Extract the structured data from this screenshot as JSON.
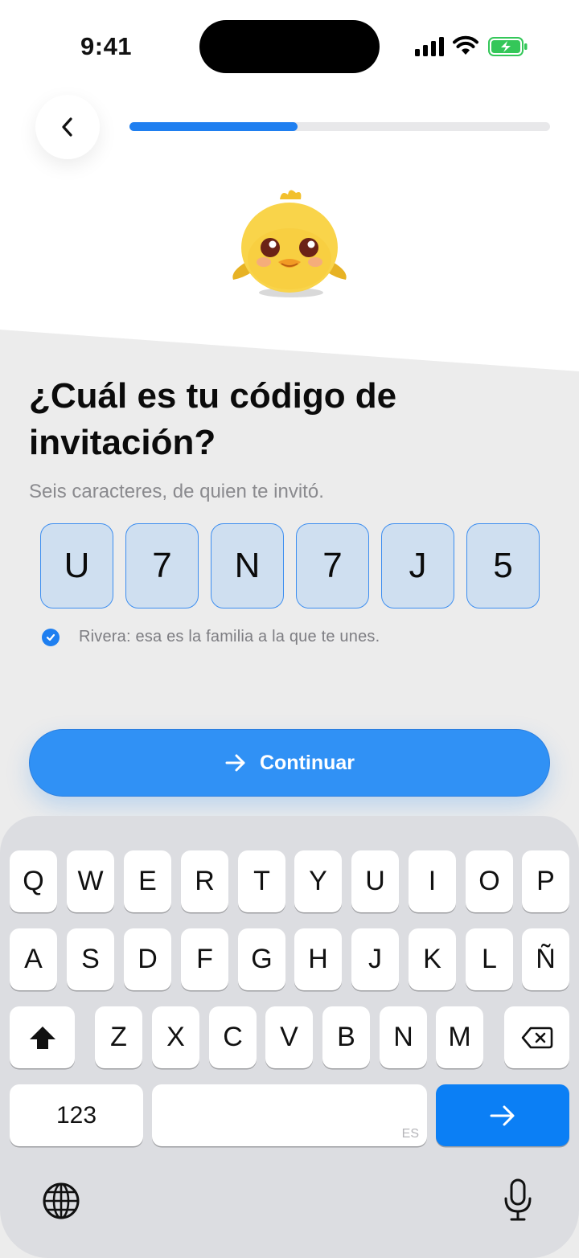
{
  "status_bar": {
    "time": "9:41"
  },
  "navigation": {
    "back_label": "‹",
    "progress_fraction": 0.4
  },
  "mascot": {
    "icon": "chick-mascot-icon"
  },
  "content": {
    "title": "¿Cuál es tu código de invitación?",
    "subtitle": "Seis caracteres, de quien te invitó.",
    "code": [
      "U",
      "7",
      "N",
      "7",
      "J",
      "5"
    ],
    "confirmation": "Rivera: esa es la familia a la que te unes."
  },
  "cta": {
    "label": "Continuar"
  },
  "keyboard": {
    "row1": [
      "Q",
      "W",
      "E",
      "R",
      "T",
      "Y",
      "U",
      "I",
      "O",
      "P"
    ],
    "row2": [
      "A",
      "S",
      "D",
      "F",
      "G",
      "H",
      "J",
      "K",
      "L",
      "Ñ"
    ],
    "row3": [
      "Z",
      "X",
      "C",
      "V",
      "B",
      "N",
      "M"
    ],
    "numbers_label": "123",
    "language_tag": "ES"
  },
  "colors": {
    "accent": "#1f7ff0",
    "cta": "#3091f5",
    "code_fill": "#cfdff0",
    "panel": "#ececec"
  }
}
